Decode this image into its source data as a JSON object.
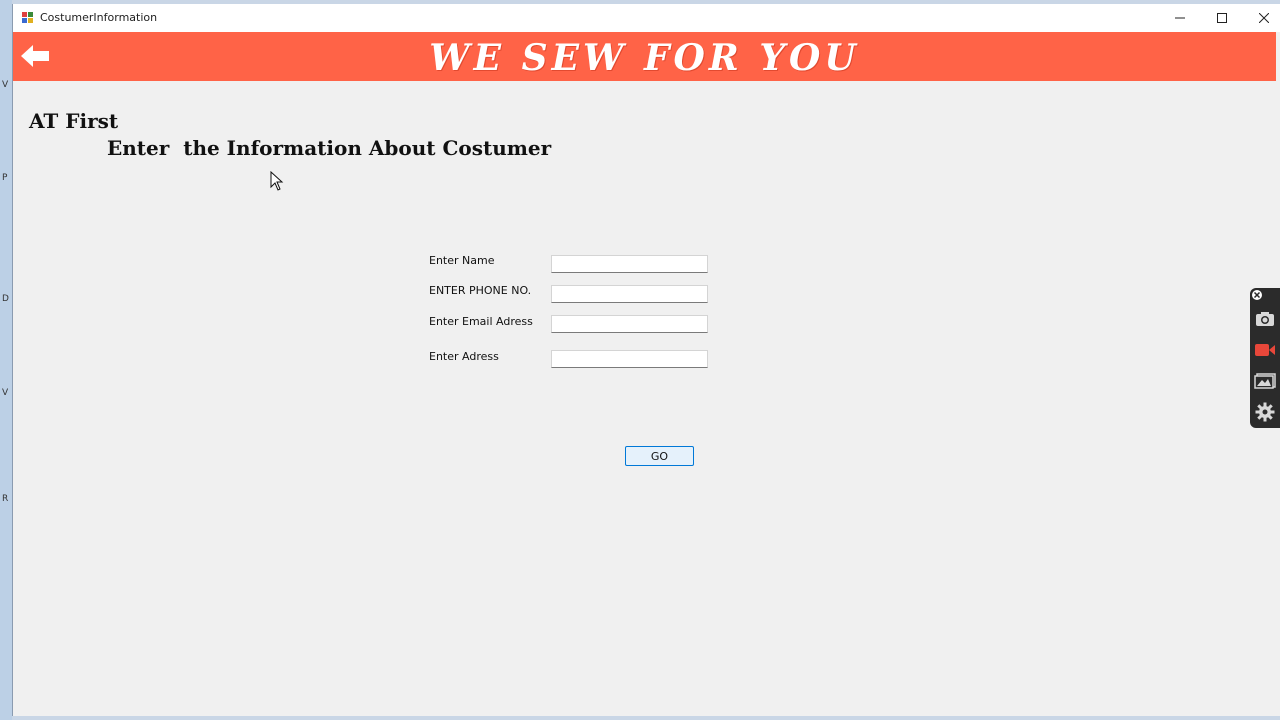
{
  "window": {
    "title": "CostumerInformation"
  },
  "banner": {
    "title": "WE SEW FOR YOU",
    "background_color": "#ff6347",
    "back_icon": "arrow-left-icon"
  },
  "headings": {
    "line1": "AT First",
    "line2": "Enter  the Information About Costumer"
  },
  "form": {
    "fields": [
      {
        "label": "Enter Name",
        "value": ""
      },
      {
        "label": "ENTER PHONE NO.",
        "value": ""
      },
      {
        "label": "Enter Email Adress",
        "value": ""
      },
      {
        "label": "Enter Adress",
        "value": ""
      }
    ],
    "submit_label": "GO"
  },
  "side_toolbar": {
    "icons": [
      "close-icon",
      "camera-icon",
      "video-camera-icon",
      "gallery-icon",
      "gear-icon"
    ],
    "record_color": "#e8473a"
  }
}
